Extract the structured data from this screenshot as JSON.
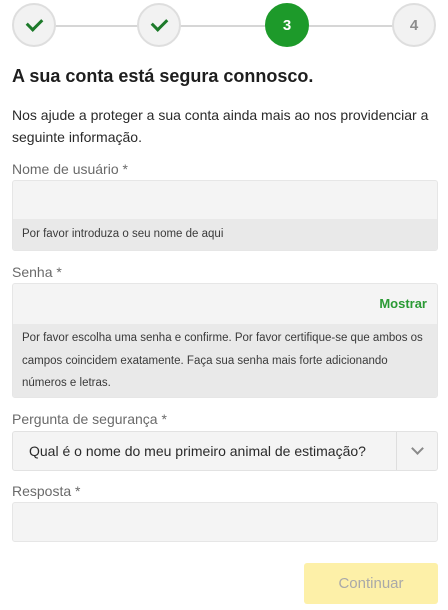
{
  "stepper": {
    "steps": [
      {
        "state": "done",
        "icon": "check-icon"
      },
      {
        "state": "done",
        "icon": "check-icon"
      },
      {
        "state": "active",
        "label": "3"
      },
      {
        "state": "pending",
        "label": "4"
      }
    ],
    "accent_color": "#1d9a2a"
  },
  "page": {
    "title": "A sua conta está segura connosco.",
    "intro": "Nos ajude a proteger a sua conta ainda mais ao nos providenciar a seguinte informação."
  },
  "username": {
    "label": "Nome de usuário *",
    "value": "",
    "hint": "Por favor introduza o seu nome de aqui"
  },
  "password": {
    "label": "Senha *",
    "value": "",
    "show_label": "Mostrar",
    "hint": "Por favor escolha uma senha e confirme. Por favor certifique-se que ambos os campos coincidem exatamente. Faça sua senha mais forte adicionando números e letras."
  },
  "security_question": {
    "label": "Pergunta de segurança *",
    "selected": "Qual é o nome do meu primeiro animal de estimação?"
  },
  "answer": {
    "label": "Resposta *",
    "value": ""
  },
  "continue_label": "Continuar"
}
